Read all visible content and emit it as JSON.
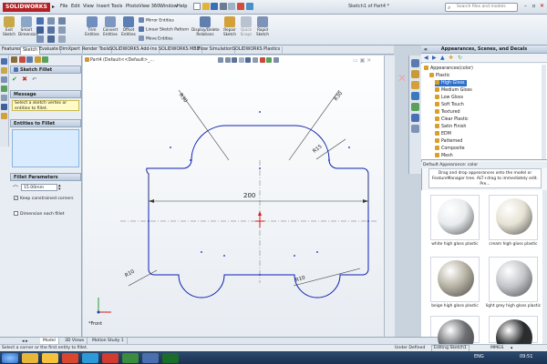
{
  "app": {
    "logo": "SOLIDWORKS",
    "document_title": "Sketch1 of Part4 *",
    "menus": [
      "File",
      "Edit",
      "View",
      "Insert",
      "Tools",
      "PhotoView 360",
      "Window",
      "Help"
    ],
    "search_placeholder": "Search files and models"
  },
  "ribbon": {
    "exit_sketch": "Exit Sketch",
    "smart_dimension": "Smart Dimension",
    "trim_entities": "Trim Entities",
    "convert_entities": "Convert Entities",
    "offset_entities": "Offset Entities",
    "mirror_entities": "Mirror Entities",
    "linear_sketch_pattern": "Linear Sketch Pattern",
    "move_entities": "Move Entities",
    "display_delete_relations": "Display/Delete Relations",
    "repair_sketch": "Repair Sketch",
    "quick_snaps": "Quick Snaps",
    "rapid_sketch": "Rapid Sketch"
  },
  "tabs": [
    "Features",
    "Sketch",
    "Evaluate",
    "DimXpert",
    "Render Tools",
    "SOLIDWORKS Add-Ins",
    "SOLIDWORKS MBD",
    "Flow Simulation",
    "SOLIDWORKS Plastics"
  ],
  "active_tab": "Sketch",
  "property_manager": {
    "title": "Sketch Fillet",
    "message_header": "Message",
    "message_text": "Select a sketch vertex or entities to fillet.",
    "entities_header": "Entities to Fillet",
    "params_header": "Fillet Parameters",
    "radius_value": "15.00mm",
    "keep_constrained": "Keep constrained corners",
    "dimension_each": "Dimension each fillet"
  },
  "canvas": {
    "breadcrumb": "Part4 (Default<<Default>_...",
    "view_label": "*Front",
    "dims": {
      "r30_left": "R30",
      "r30_right": "R30",
      "r15": "R15",
      "width": "200",
      "r10_left": "R10",
      "r10_right": "R10"
    }
  },
  "bottom_tabs": [
    "Model",
    "3D Views",
    "Motion Study 1"
  ],
  "status": {
    "left": "Select a corner or the first entity to fillet.",
    "state": "Under Defined",
    "editing": "Editing Sketch1",
    "units": "MMGS"
  },
  "appearances": {
    "title": "Appearances, Scenes, and Decals",
    "tree": [
      {
        "label": "Appearances(color)",
        "depth": 0
      },
      {
        "label": "Plastic",
        "depth": 1
      },
      {
        "label": "High Gloss",
        "depth": 2,
        "selected": true
      },
      {
        "label": "Medium Gloss",
        "depth": 2
      },
      {
        "label": "Low Gloss",
        "depth": 2
      },
      {
        "label": "Soft Touch",
        "depth": 2
      },
      {
        "label": "Textured",
        "depth": 2
      },
      {
        "label": "Clear Plastic",
        "depth": 2
      },
      {
        "label": "Satin Finish",
        "depth": 2
      },
      {
        "label": "EDM",
        "depth": 2
      },
      {
        "label": "Patterned",
        "depth": 2
      },
      {
        "label": "Composite",
        "depth": 2
      },
      {
        "label": "Mesh",
        "depth": 2
      }
    ],
    "default_label": "Default Appearance: color",
    "description": "Drag and drop appearances onto the model or FeatureManager tree. ALT+drag to immediately edit. Pre...",
    "swatches": [
      {
        "label": "white high gloss plastic",
        "color": "#e8ecef"
      },
      {
        "label": "cream high gloss plastic",
        "color": "#e6e2d4"
      },
      {
        "label": "beige high gloss plastic",
        "color": "#b7b2a3"
      },
      {
        "label": "light grey high gloss plastic",
        "color": "#c3c6ca"
      },
      {
        "label": "",
        "color": "#6d6f72"
      },
      {
        "label": "",
        "color": "#2a2b2d"
      }
    ]
  },
  "taskbar": {
    "time": "09:51",
    "lang": "ENG"
  }
}
